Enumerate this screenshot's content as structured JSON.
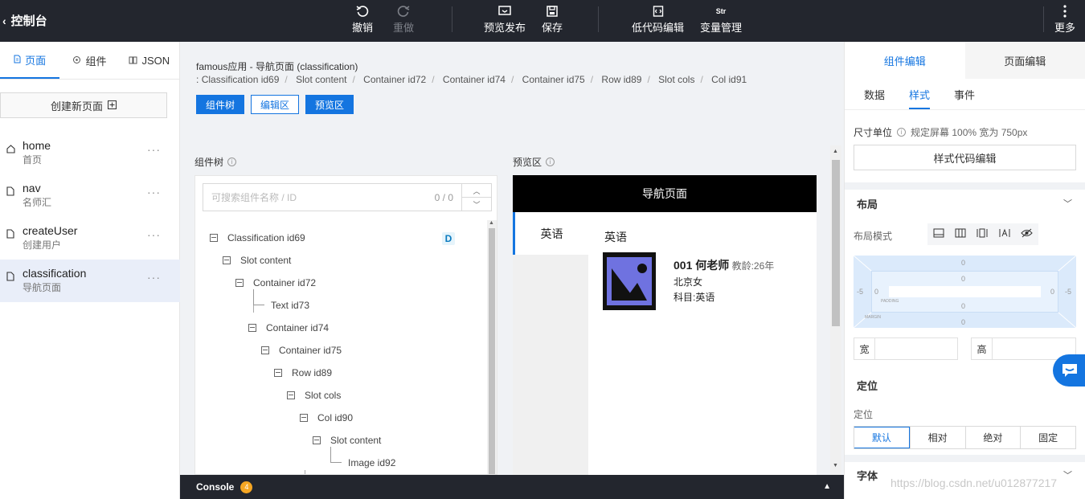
{
  "topbar": {
    "back_label": "控制台",
    "undo": "撤销",
    "redo": "重做",
    "preview_publish": "预览发布",
    "save": "保存",
    "lowcode_edit": "低代码编辑",
    "var_manage": "变量管理",
    "var_icon_text": "Str",
    "more": "更多"
  },
  "left": {
    "tabs": [
      {
        "label": "页面",
        "icon": "file-icon"
      },
      {
        "label": "组件",
        "icon": "component-icon"
      },
      {
        "label": "JSON",
        "icon": "book-icon"
      }
    ],
    "create_label": "创建新页面",
    "pages": [
      {
        "name": "home",
        "sub": "首页",
        "icon": "home-icon"
      },
      {
        "name": "nav",
        "sub": "名师汇",
        "icon": "file-icon"
      },
      {
        "name": "createUser",
        "sub": "创建用户",
        "icon": "file-icon"
      },
      {
        "name": "classification",
        "sub": "导航页面",
        "icon": "file-icon"
      }
    ],
    "more_glyph": "···"
  },
  "center": {
    "page_title": "famous应用 - 导航页面 (classification)",
    "breadcrumb_prefix": ":",
    "breadcrumb": [
      "Classification id69",
      "Slot content",
      "Container id72",
      "Container id74",
      "Container id75",
      "Row id89",
      "Slot cols",
      "Col id91"
    ],
    "breadcrumb_sep": "/",
    "modes": [
      "组件树",
      "编辑区",
      "预览区"
    ],
    "tree_label": "组件树",
    "preview_label": "预览区",
    "search_placeholder": "可搜索组件名称 / ID",
    "search_count": "0 / 0",
    "d_badge": "D",
    "tree": [
      {
        "label": "Classification id69",
        "type": "box"
      },
      {
        "label": "Slot content",
        "type": "box"
      },
      {
        "label": "Container id72",
        "type": "box"
      },
      {
        "label": "Text id73",
        "type": "leaf"
      },
      {
        "label": "Container id74",
        "type": "box"
      },
      {
        "label": "Container id75",
        "type": "box"
      },
      {
        "label": "Row id89",
        "type": "box"
      },
      {
        "label": "Slot cols",
        "type": "box"
      },
      {
        "label": "Col id90",
        "type": "box"
      },
      {
        "label": "Slot content",
        "type": "box"
      },
      {
        "label": "Image id92",
        "type": "leaf"
      }
    ]
  },
  "preview": {
    "nav_title": "导航页面",
    "side_tab": "英语",
    "heading": "英语",
    "teacher_name": "001 何老师",
    "experience": "教龄:26年",
    "location": "北京女",
    "subject": "科目:英语",
    "image_bg": "#6f72e0"
  },
  "console": {
    "label": "Console",
    "count": "4"
  },
  "right": {
    "tabs": [
      "组件编辑",
      "页面编辑"
    ],
    "subtabs": [
      "数据",
      "样式",
      "事件"
    ],
    "unit_label": "尺寸单位",
    "unit_value": "规定屏幕 100% 宽为 750px",
    "style_code_btn": "样式代码编辑",
    "layout_title": "布局",
    "layout_mode_label": "布局模式",
    "box_model": {
      "outer_top": "0",
      "inner_top": "0",
      "inner_bottom": "0",
      "outer_bottom": "0",
      "outer_left": "-5",
      "inner_left": "0",
      "inner_right": "0",
      "outer_right": "-5",
      "padding_tag": "PADDING",
      "margin_tag": "MARGIN"
    },
    "width_label": "宽",
    "height_label": "高",
    "position_title": "定位",
    "position_label": "定位",
    "position_options": [
      "默认",
      "相对",
      "绝对",
      "固定"
    ],
    "font_title": "字体"
  },
  "watermark": "https://blog.csdn.net/u012877217",
  "colors": {
    "accent": "#1475e0",
    "topbar": "#23262e",
    "badge": "#f5a623"
  }
}
